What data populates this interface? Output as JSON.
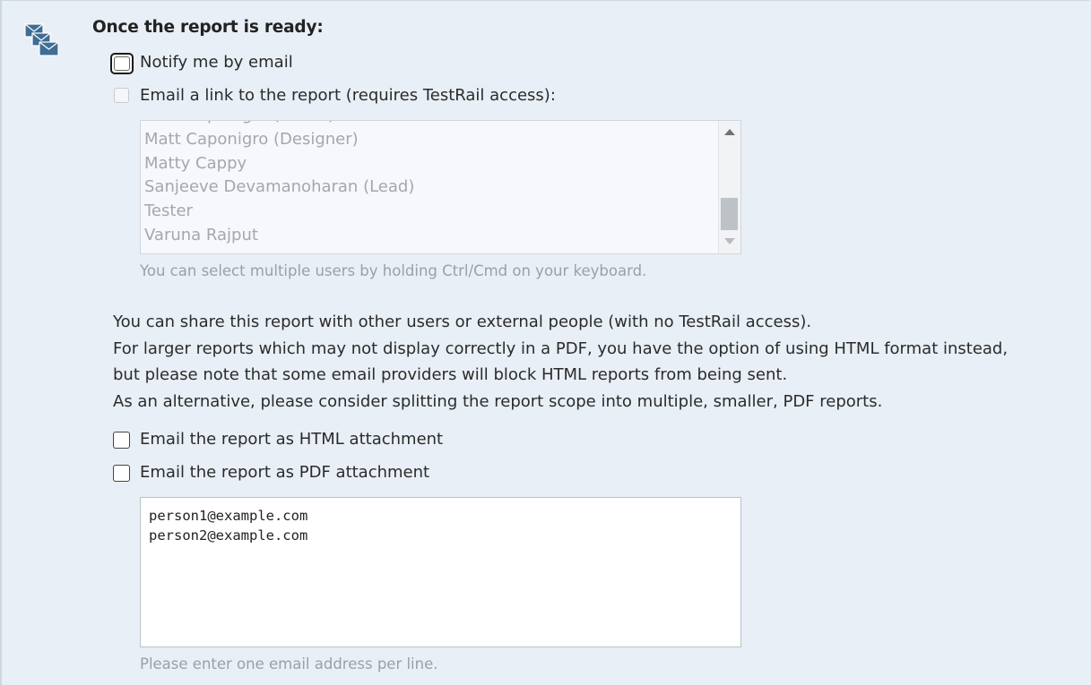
{
  "section": {
    "heading": "Once the report is ready:",
    "icon": "envelopes-icon"
  },
  "notify": {
    "label": "Notify me by email",
    "checked": false
  },
  "email_link": {
    "label": "Email a link to the report (requires TestRail access):",
    "checked": false,
    "disabled": true,
    "users": [
      "Matt Caponigro (Tester)",
      "Matt Caponigro (Designer)",
      "Matty Cappy",
      "Sanjeeve Devamanoharan (Lead)",
      "Tester",
      "Varuna Rajput"
    ],
    "hint": "You can select multiple users by holding Ctrl/Cmd on your keyboard."
  },
  "info": {
    "lines": [
      "You can share this report with other users or external people (with no TestRail access).",
      "For larger reports which may not display correctly in a PDF, you have the option of using HTML format instead,",
      "but please note that some email providers will block HTML reports from being sent.",
      "As an alternative, please consider splitting the report scope into multiple, smaller, PDF reports."
    ]
  },
  "html_attachment": {
    "label": "Email the report as HTML attachment",
    "checked": false
  },
  "pdf_attachment": {
    "label": "Email the report as PDF attachment",
    "checked": false
  },
  "emails": {
    "value": "person1@example.com\nperson2@example.com",
    "hint": "Please enter one email address per line."
  },
  "colors": {
    "background": "#e9eff6",
    "icon_blue": "#3f6d93",
    "muted_text": "#9aa0a6"
  }
}
